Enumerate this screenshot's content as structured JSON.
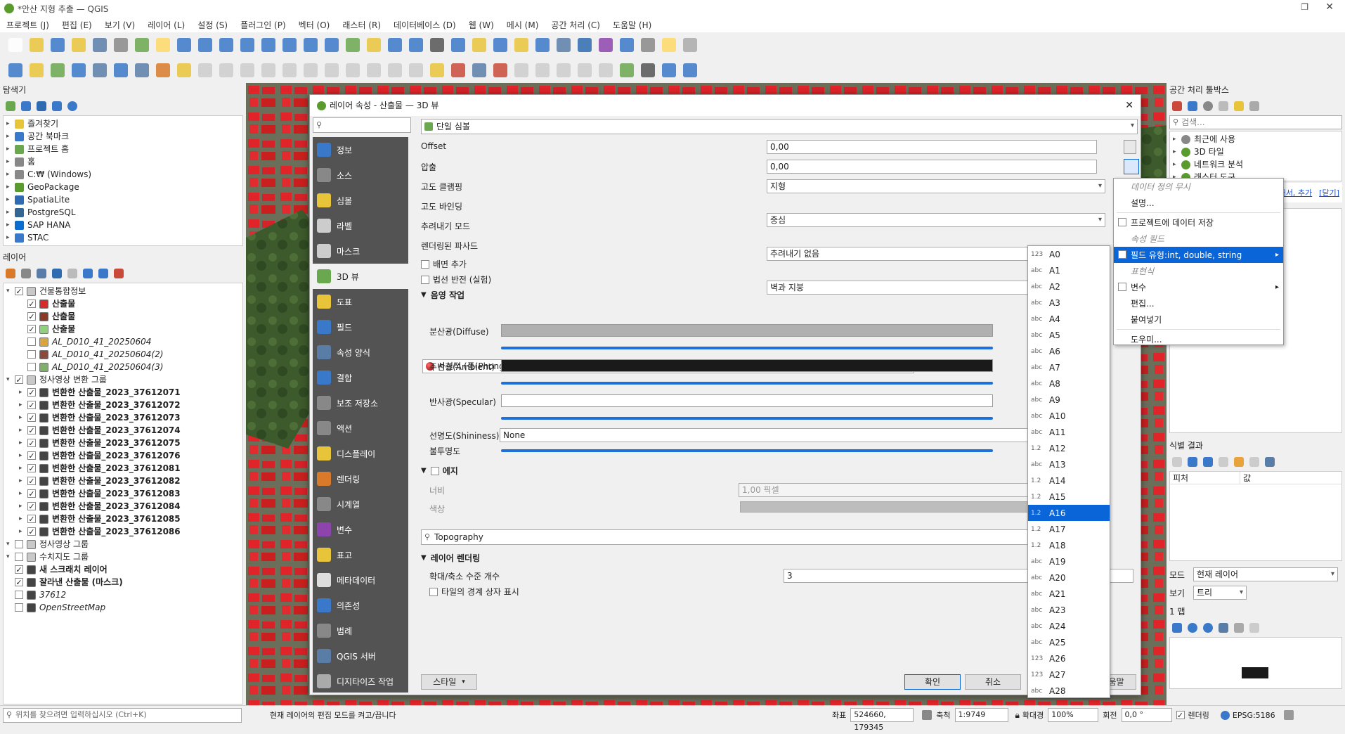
{
  "window": {
    "title": "*안산 지형 추출 — QGIS"
  },
  "menu": [
    "프로젝트 (J)",
    "편집 (E)",
    "보기 (V)",
    "레이어 (L)",
    "설정 (S)",
    "플러그인 (P)",
    "벡터 (O)",
    "래스터 (R)",
    "데이터베이스 (D)",
    "웹 (W)",
    "메시 (M)",
    "공간 처리 (C)",
    "도움말 (H)"
  ],
  "browser": {
    "title": "탐색기",
    "items": [
      "즐겨찾기",
      "공간 북마크",
      "프로젝트 홈",
      "홈",
      "C:₩ (Windows)",
      "GeoPackage",
      "SpatiaLite",
      "PostgreSQL",
      "SAP HANA",
      "STAC"
    ]
  },
  "layers": {
    "title": "레이어",
    "items": [
      {
        "label": "건물통합정보",
        "depth": 0,
        "checked": true,
        "group": true
      },
      {
        "label": "산출물",
        "depth": 1,
        "checked": true,
        "color": "#d92a2a",
        "bold": true
      },
      {
        "label": "산출물",
        "depth": 1,
        "checked": true,
        "color": "#8b3a2a",
        "bold": true
      },
      {
        "label": "산출물",
        "depth": 1,
        "checked": true,
        "color": "#8fd07a",
        "bold": true
      },
      {
        "label": "AL_D010_41_20250604",
        "depth": 1,
        "checked": false,
        "color": "#d9a43a",
        "italic": true
      },
      {
        "label": "AL_D010_41_20250604(2)",
        "depth": 1,
        "checked": false,
        "color": "#8b4a3a",
        "italic": true
      },
      {
        "label": "AL_D010_41_20250604(3)",
        "depth": 1,
        "checked": false,
        "color": "#7fb06a",
        "italic": true
      },
      {
        "label": "정사영상 변환 그룹",
        "depth": 0,
        "checked": true,
        "group": true
      },
      {
        "label": "변환한 산출물_2023_37612071",
        "depth": 1,
        "checked": true,
        "bold": true
      },
      {
        "label": "변환한 산출물_2023_37612072",
        "depth": 1,
        "checked": true,
        "bold": true
      },
      {
        "label": "변환한 산출물_2023_37612073",
        "depth": 1,
        "checked": true,
        "bold": true
      },
      {
        "label": "변환한 산출물_2023_37612074",
        "depth": 1,
        "checked": true,
        "bold": true
      },
      {
        "label": "변환한 산출물_2023_37612075",
        "depth": 1,
        "checked": true,
        "bold": true
      },
      {
        "label": "변환한 산출물_2023_37612076",
        "depth": 1,
        "checked": true,
        "bold": true
      },
      {
        "label": "변환한 산출물_2023_37612081",
        "depth": 1,
        "checked": true,
        "bold": true
      },
      {
        "label": "변환한 산출물_2023_37612082",
        "depth": 1,
        "checked": true,
        "bold": true
      },
      {
        "label": "변환한 산출물_2023_37612083",
        "depth": 1,
        "checked": true,
        "bold": true
      },
      {
        "label": "변환한 산출물_2023_37612084",
        "depth": 1,
        "checked": true,
        "bold": true
      },
      {
        "label": "변환한 산출물_2023_37612085",
        "depth": 1,
        "checked": true,
        "bold": true
      },
      {
        "label": "변환한 산출물_2023_37612086",
        "depth": 1,
        "checked": true,
        "bold": true
      },
      {
        "label": "정사영상 그룹",
        "depth": 0,
        "checked": false,
        "group": true
      },
      {
        "label": "수치지도 그룹",
        "depth": 0,
        "checked": false,
        "group": true
      },
      {
        "label": "새 스크래치 레이어",
        "depth": 0,
        "checked": true,
        "bold": true
      },
      {
        "label": "잘라낸 산출물 (마스크)",
        "depth": 0,
        "checked": true,
        "bold": true
      },
      {
        "label": "37612",
        "depth": 0,
        "checked": false,
        "italic": true
      },
      {
        "label": "OpenStreetMap",
        "depth": 0,
        "checked": false,
        "italic": true
      }
    ]
  },
  "dialog": {
    "title": "레이어 속성 - 산출물 — 3D 뷰",
    "sidebar": [
      "정보",
      "소스",
      "심볼",
      "라벨",
      "마스크",
      "3D 뷰",
      "도표",
      "필드",
      "속성 양식",
      "결합",
      "보조 저장소",
      "액션",
      "디스플레이",
      "렌더링",
      "시계열",
      "변수",
      "표고",
      "메타데이터",
      "의존성",
      "범례",
      "QGIS 서버",
      "디지타이즈 작업"
    ],
    "search_placeholder": "",
    "renderer": "단일 심볼",
    "offset_label": "Offset",
    "offset_value": "0,00",
    "extrusion_label": "압출",
    "extrusion_value": "0,00",
    "clamp_label": "고도 클램핑",
    "clamp_value": "지형",
    "binding_label": "고도 바인딩",
    "binding_value": "중심",
    "cull_label": "추려내기 모드",
    "cull_value": "추려내기 없음",
    "facade_label": "렌더링된 파사드",
    "facade_value": "벽과 지붕",
    "add_back": "배면 추가",
    "invert_normals": "법선 반전 (실험)",
    "shading_label": "음영 작업",
    "shading_model": "사실적 (퐁(Phong))",
    "diffuse": "분산광(Diffuse)",
    "ambient": "주변광(Ambient)",
    "specular": "반사광(Specular)",
    "shininess": "선명도(Shininess)",
    "shininess_value": "None",
    "opacity": "불투명도",
    "edges_label": "에지",
    "width_label": "너비",
    "width_value": "1,00 픽셀",
    "color_label": "색상",
    "topography": "Topography",
    "layer_render": "레이어 렌더링",
    "zoom_levels_label": "확대/축소 수준 개수",
    "zoom_levels_value": "3",
    "tile_bbox": "타일의 경계 상자 표시",
    "style_button": "스타일",
    "ok": "확인",
    "cancel": "취소",
    "help": "도움말"
  },
  "field_list": [
    {
      "type": "123",
      "name": "A0"
    },
    {
      "type": "abc",
      "name": "A1"
    },
    {
      "type": "abc",
      "name": "A2"
    },
    {
      "type": "abc",
      "name": "A3"
    },
    {
      "type": "abc",
      "name": "A4"
    },
    {
      "type": "abc",
      "name": "A5"
    },
    {
      "type": "abc",
      "name": "A6"
    },
    {
      "type": "abc",
      "name": "A7"
    },
    {
      "type": "abc",
      "name": "A8"
    },
    {
      "type": "abc",
      "name": "A9"
    },
    {
      "type": "abc",
      "name": "A10"
    },
    {
      "type": "abc",
      "name": "A11"
    },
    {
      "type": "1.2",
      "name": "A12"
    },
    {
      "type": "abc",
      "name": "A13"
    },
    {
      "type": "1.2",
      "name": "A14"
    },
    {
      "type": "1.2",
      "name": "A15"
    },
    {
      "type": "1.2",
      "name": "A16",
      "selected": true
    },
    {
      "type": "1.2",
      "name": "A17"
    },
    {
      "type": "1.2",
      "name": "A18"
    },
    {
      "type": "abc",
      "name": "A19"
    },
    {
      "type": "abc",
      "name": "A20"
    },
    {
      "type": "abc",
      "name": "A21"
    },
    {
      "type": "abc",
      "name": "A23"
    },
    {
      "type": "abc",
      "name": "A24"
    },
    {
      "type": "abc",
      "name": "A25"
    },
    {
      "type": "123",
      "name": "A26"
    },
    {
      "type": "123",
      "name": "A27"
    },
    {
      "type": "abc",
      "name": "A28"
    }
  ],
  "context_menu": {
    "items": [
      {
        "label": "데이터 정의 무시",
        "kind": "disabled"
      },
      {
        "label": "설명...",
        "kind": "item"
      },
      {
        "kind": "sep"
      },
      {
        "label": "프로젝트에 데이터 저장",
        "kind": "check"
      },
      {
        "label": "속성 필드",
        "kind": "disabled"
      },
      {
        "label": "필드 유형:int, double, string",
        "kind": "check",
        "highlight": true,
        "submenu": true
      },
      {
        "label": "표현식",
        "kind": "disabled"
      },
      {
        "label": "변수",
        "kind": "check",
        "submenu": true
      },
      {
        "label": "편집...",
        "kind": "item"
      },
      {
        "label": "붙여넣기",
        "kind": "item"
      },
      {
        "kind": "sep"
      },
      {
        "label": "도우미...",
        "kind": "item"
      }
    ]
  },
  "processing": {
    "title": "공간 처리 툴박스",
    "search_placeholder": "검색...",
    "items": [
      "최근에 사용",
      "3D 타일",
      "네트워크 분석",
      "래스터 도구"
    ],
    "link_text": "추가해서, 추가",
    "close_link": "[닫기]"
  },
  "identify": {
    "title": "식별 결과",
    "col_feature": "피처",
    "col_value": "값",
    "mode_label": "모드",
    "mode_value": "현재 레이어",
    "view_label": "보기",
    "view_value": "트리",
    "map_label": "1 맵"
  },
  "status": {
    "locate_placeholder": "위치를 찾으려면 입력하십시오 (Ctrl+K)",
    "message": "현재 레이어의 편집 모드를 켜고/끕니다",
    "coord_label": "좌표",
    "coord_value": "524660, 179345",
    "scale_label": "축척",
    "scale_value": "1:9749",
    "magnifier_label": "확대경",
    "magnifier_value": "100%",
    "rotation_label": "회전",
    "rotation_value": "0,0 °",
    "render_label": "렌더링",
    "crs": "EPSG:5186"
  }
}
